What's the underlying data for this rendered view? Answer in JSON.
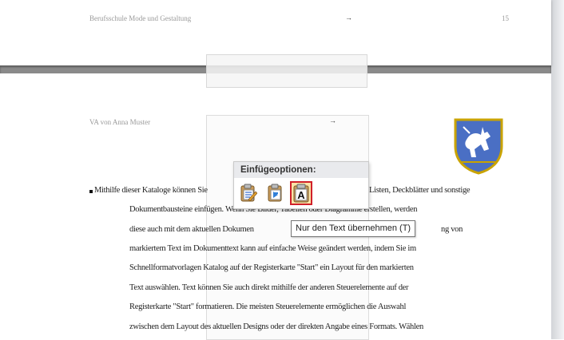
{
  "header": {
    "left_text": "Berufsschule Mode und Gestaltung",
    "arrow": "→",
    "page_number": "15"
  },
  "author_line": "VA von Anna Muster",
  "body_arrow": "→",
  "paste_options": {
    "title": "Einfügeoptionen:",
    "options": [
      {
        "icon": "keep-source-formatting-icon"
      },
      {
        "icon": "merge-formatting-icon"
      },
      {
        "icon": "keep-text-only-icon",
        "label": "A"
      }
    ],
    "tooltip": "Nur den Text übernehmen (T)"
  },
  "body_lines": [
    "Mithilfe dieser Kataloge können Sie",
    "Listen, Deckblätter und sonstige",
    "Dokumentbausteine einfügen. Wenn Sie Bilder, Tabellen oder Diagramme erstellen, werden",
    "diese auch mit dem aktuellen Dokumen",
    "ng von",
    "markiertem Text im Dokumenttext kann auf einfache Weise geändert werden, indem Sie im",
    "Schnellformatvorlagen Katalog auf der Registerkarte \"Start\" ein Layout für den markierten",
    "Text auswählen. Text können Sie auch direkt mithilfe der anderen Steuerelemente auf der",
    "Registerkarte \"Start\" formatieren. Die meisten Steuerelemente ermöglichen die Auswahl",
    "zwischen dem Layout des aktuellen Designs oder der direkten Angabe eines Formats. Wählen"
  ],
  "colors": {
    "page_gap": "#8a8a8a",
    "selected_option_border": "#d0202a",
    "selected_option_fill": "#fbe3a7",
    "crest_blue": "#4a6fc4"
  }
}
